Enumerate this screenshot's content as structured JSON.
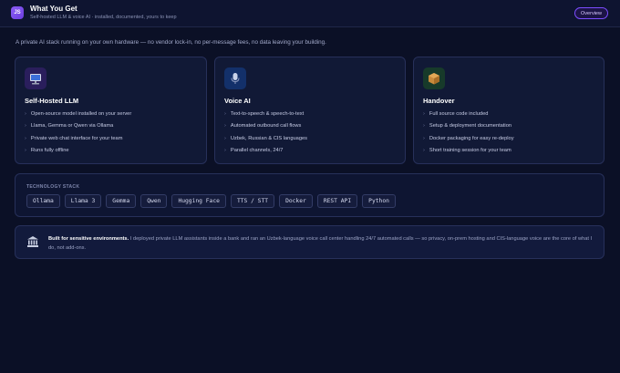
{
  "header": {
    "logo_text": "JS",
    "title": "What You Get",
    "subtitle": "Self-hosted LLM & voice AI · installed, documented, yours to keep",
    "overview_label": "Overview"
  },
  "intro": "A private AI stack running on your own hardware — no vendor lock-in, no per-message fees, no data leaving your building.",
  "cards": [
    {
      "icon": "computer-icon",
      "title": "Self-Hosted LLM",
      "items": [
        "Open-source model installed on your server",
        "Llama, Gemma or Qwen via Ollama",
        "Private web chat interface for your team",
        "Runs fully offline"
      ]
    },
    {
      "icon": "microphone-icon",
      "title": "Voice AI",
      "items": [
        "Text-to-speech & speech-to-text",
        "Automated outbound call flows",
        "Uzbek, Russian & CIS languages",
        "Parallel channels, 24/7"
      ]
    },
    {
      "icon": "package-icon",
      "title": "Handover",
      "items": [
        "Full source code included",
        "Setup & deployment documentation",
        "Docker packaging for easy re-deploy",
        "Short training session for your team"
      ]
    }
  ],
  "stack": {
    "title": "TECHNOLOGY STACK",
    "chips": [
      "Ollama",
      "Llama 3",
      "Gemma",
      "Qwen",
      "Hugging Face",
      "TTS / STT",
      "Docker",
      "REST API",
      "Python"
    ]
  },
  "note": {
    "icon": "bank-icon",
    "bold": "Built for sensitive environments.",
    "text": " I deployed private LLM assistants inside a bank and ran an Uzbek-language voice call center handling 24/7 automated calls — so privacy, on-prem hosting and CIS-language voice are the core of what I do, not add-ons."
  },
  "colors": {
    "background": "#0b1026",
    "accent": "#7c4dff",
    "card_border": "#27305a"
  }
}
